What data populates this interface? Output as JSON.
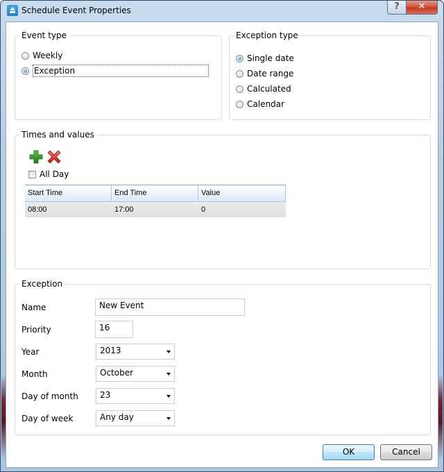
{
  "window": {
    "title": "Schedule Event Properties",
    "help_glyph": "?",
    "close_glyph": "✕"
  },
  "event_type": {
    "title": "Event type",
    "options": [
      {
        "label": "Weekly",
        "checked": false
      },
      {
        "label": "Exception",
        "checked": true
      }
    ]
  },
  "exception_type": {
    "title": "Exception type",
    "options": [
      {
        "label": "Single date",
        "checked": true
      },
      {
        "label": "Date range",
        "checked": false
      },
      {
        "label": "Calculated",
        "checked": false
      },
      {
        "label": "Calendar",
        "checked": false
      }
    ]
  },
  "times": {
    "title": "Times and values",
    "add_icon": "add-icon",
    "delete_icon": "delete-icon",
    "all_day_label": "All Day",
    "all_day_checked": false,
    "columns": [
      "Start Time",
      "End Time",
      "Value"
    ],
    "rows": [
      [
        "08:00",
        "17:00",
        "0"
      ]
    ]
  },
  "exception": {
    "title": "Exception",
    "name_label": "Name",
    "name_value": "New Event",
    "priority_label": "Priority",
    "priority_value": "16",
    "year_label": "Year",
    "year_value": "2013",
    "month_label": "Month",
    "month_value": "October",
    "day_of_month_label": "Day of month",
    "day_of_month_value": "23",
    "day_of_week_label": "Day of week",
    "day_of_week_value": "Any day"
  },
  "buttons": {
    "ok": "OK",
    "cancel": "Cancel"
  }
}
